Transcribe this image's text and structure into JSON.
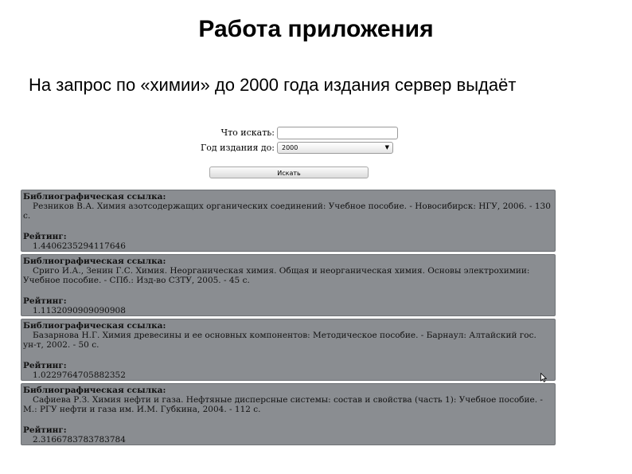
{
  "slide": {
    "title": "Работа приложения",
    "subtitle": "На запрос по «химии» до 2000 года издания сервер выдаёт"
  },
  "form": {
    "query_label": "Что искать:",
    "query_value": "",
    "year_label": "Год издания до:",
    "year_value": "2000",
    "search_button": "Искать"
  },
  "results": [
    {
      "ref_label": "Библиографическая ссылка:",
      "ref_text": "Резников В.А. Химия азотсодержащих органических соединений: Учебное пособие. - Новосибирск: НГУ, 2006. - 130 с.",
      "rating_label": "Рейтинг:",
      "rating_value": "1.4406235294117646"
    },
    {
      "ref_label": "Библиографическая ссылка:",
      "ref_text": "Сриго И.А., Зенин Г.С. Химия. Неорганическая химия. Общая и неорганическая химия. Основы электрохимии: Учебное пособие. - СПб.: Изд-во СЗТУ, 2005. - 45 с.",
      "rating_label": "Рейтинг:",
      "rating_value": "1.1132090909090908"
    },
    {
      "ref_label": "Библиографическая ссылка:",
      "ref_text": "Базарнова Н.Г. Химия древесины и ее основных компонентов: Методическое пособие. - Барнаул: Алтайский гос. ун-т, 2002. - 50 с.",
      "rating_label": "Рейтинг:",
      "rating_value": "1.0229764705882352"
    },
    {
      "ref_label": "Библиографическая ссылка:",
      "ref_text": "Сафиева Р.З. Химия нефти и газа. Нефтяные дисперсные системы: состав и свойства (часть 1): Учебное пособие. - М.: РГУ нефти и газа им. И.М. Губкина, 2004. - 112 с.",
      "rating_label": "Рейтинг:",
      "rating_value": "2.3166783783783784"
    }
  ]
}
